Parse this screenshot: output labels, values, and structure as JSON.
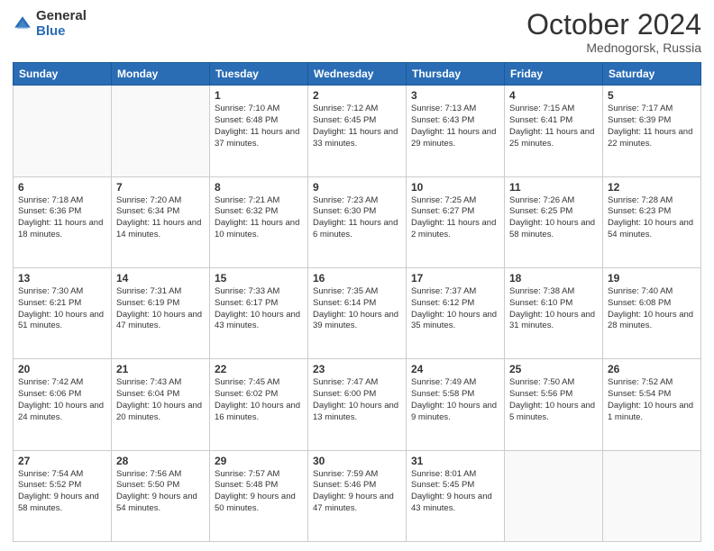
{
  "logo": {
    "general": "General",
    "blue": "Blue"
  },
  "title": "October 2024",
  "location": "Mednogorsk, Russia",
  "days_header": [
    "Sunday",
    "Monday",
    "Tuesday",
    "Wednesday",
    "Thursday",
    "Friday",
    "Saturday"
  ],
  "weeks": [
    [
      {
        "day": "",
        "info": ""
      },
      {
        "day": "",
        "info": ""
      },
      {
        "day": "1",
        "info": "Sunrise: 7:10 AM\nSunset: 6:48 PM\nDaylight: 11 hours and 37 minutes."
      },
      {
        "day": "2",
        "info": "Sunrise: 7:12 AM\nSunset: 6:45 PM\nDaylight: 11 hours and 33 minutes."
      },
      {
        "day": "3",
        "info": "Sunrise: 7:13 AM\nSunset: 6:43 PM\nDaylight: 11 hours and 29 minutes."
      },
      {
        "day": "4",
        "info": "Sunrise: 7:15 AM\nSunset: 6:41 PM\nDaylight: 11 hours and 25 minutes."
      },
      {
        "day": "5",
        "info": "Sunrise: 7:17 AM\nSunset: 6:39 PM\nDaylight: 11 hours and 22 minutes."
      }
    ],
    [
      {
        "day": "6",
        "info": "Sunrise: 7:18 AM\nSunset: 6:36 PM\nDaylight: 11 hours and 18 minutes."
      },
      {
        "day": "7",
        "info": "Sunrise: 7:20 AM\nSunset: 6:34 PM\nDaylight: 11 hours and 14 minutes."
      },
      {
        "day": "8",
        "info": "Sunrise: 7:21 AM\nSunset: 6:32 PM\nDaylight: 11 hours and 10 minutes."
      },
      {
        "day": "9",
        "info": "Sunrise: 7:23 AM\nSunset: 6:30 PM\nDaylight: 11 hours and 6 minutes."
      },
      {
        "day": "10",
        "info": "Sunrise: 7:25 AM\nSunset: 6:27 PM\nDaylight: 11 hours and 2 minutes."
      },
      {
        "day": "11",
        "info": "Sunrise: 7:26 AM\nSunset: 6:25 PM\nDaylight: 10 hours and 58 minutes."
      },
      {
        "day": "12",
        "info": "Sunrise: 7:28 AM\nSunset: 6:23 PM\nDaylight: 10 hours and 54 minutes."
      }
    ],
    [
      {
        "day": "13",
        "info": "Sunrise: 7:30 AM\nSunset: 6:21 PM\nDaylight: 10 hours and 51 minutes."
      },
      {
        "day": "14",
        "info": "Sunrise: 7:31 AM\nSunset: 6:19 PM\nDaylight: 10 hours and 47 minutes."
      },
      {
        "day": "15",
        "info": "Sunrise: 7:33 AM\nSunset: 6:17 PM\nDaylight: 10 hours and 43 minutes."
      },
      {
        "day": "16",
        "info": "Sunrise: 7:35 AM\nSunset: 6:14 PM\nDaylight: 10 hours and 39 minutes."
      },
      {
        "day": "17",
        "info": "Sunrise: 7:37 AM\nSunset: 6:12 PM\nDaylight: 10 hours and 35 minutes."
      },
      {
        "day": "18",
        "info": "Sunrise: 7:38 AM\nSunset: 6:10 PM\nDaylight: 10 hours and 31 minutes."
      },
      {
        "day": "19",
        "info": "Sunrise: 7:40 AM\nSunset: 6:08 PM\nDaylight: 10 hours and 28 minutes."
      }
    ],
    [
      {
        "day": "20",
        "info": "Sunrise: 7:42 AM\nSunset: 6:06 PM\nDaylight: 10 hours and 24 minutes."
      },
      {
        "day": "21",
        "info": "Sunrise: 7:43 AM\nSunset: 6:04 PM\nDaylight: 10 hours and 20 minutes."
      },
      {
        "day": "22",
        "info": "Sunrise: 7:45 AM\nSunset: 6:02 PM\nDaylight: 10 hours and 16 minutes."
      },
      {
        "day": "23",
        "info": "Sunrise: 7:47 AM\nSunset: 6:00 PM\nDaylight: 10 hours and 13 minutes."
      },
      {
        "day": "24",
        "info": "Sunrise: 7:49 AM\nSunset: 5:58 PM\nDaylight: 10 hours and 9 minutes."
      },
      {
        "day": "25",
        "info": "Sunrise: 7:50 AM\nSunset: 5:56 PM\nDaylight: 10 hours and 5 minutes."
      },
      {
        "day": "26",
        "info": "Sunrise: 7:52 AM\nSunset: 5:54 PM\nDaylight: 10 hours and 1 minute."
      }
    ],
    [
      {
        "day": "27",
        "info": "Sunrise: 7:54 AM\nSunset: 5:52 PM\nDaylight: 9 hours and 58 minutes."
      },
      {
        "day": "28",
        "info": "Sunrise: 7:56 AM\nSunset: 5:50 PM\nDaylight: 9 hours and 54 minutes."
      },
      {
        "day": "29",
        "info": "Sunrise: 7:57 AM\nSunset: 5:48 PM\nDaylight: 9 hours and 50 minutes."
      },
      {
        "day": "30",
        "info": "Sunrise: 7:59 AM\nSunset: 5:46 PM\nDaylight: 9 hours and 47 minutes."
      },
      {
        "day": "31",
        "info": "Sunrise: 8:01 AM\nSunset: 5:45 PM\nDaylight: 9 hours and 43 minutes."
      },
      {
        "day": "",
        "info": ""
      },
      {
        "day": "",
        "info": ""
      }
    ]
  ]
}
